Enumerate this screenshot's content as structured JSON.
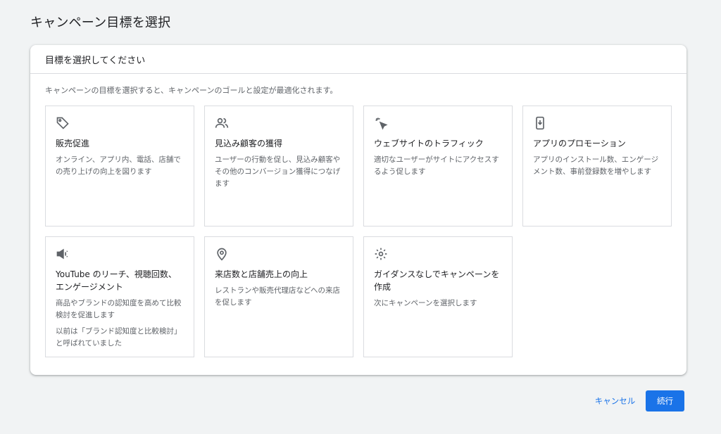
{
  "page_title": "キャンペーン目標を選択",
  "card": {
    "header": "目標を選択してください",
    "description": "キャンペーンの目標を選択すると、キャンペーンのゴールと設定が最適化されます。"
  },
  "goals": [
    {
      "icon": "tag-icon",
      "title": "販売促進",
      "description": "オンライン、アプリ内、電話、店舗での売り上げの向上を図ります",
      "note": ""
    },
    {
      "icon": "people-icon",
      "title": "見込み顧客の獲得",
      "description": "ユーザーの行動を促し、見込み顧客やその他のコンバージョン獲得につなげます",
      "note": ""
    },
    {
      "icon": "cursor-click-icon",
      "title": "ウェブサイトのトラフィック",
      "description": "適切なユーザーがサイトにアクセスするよう促します",
      "note": ""
    },
    {
      "icon": "phone-download-icon",
      "title": "アプリのプロモーション",
      "description": "アプリのインストール数、エンゲージメント数、事前登録数を増やします",
      "note": ""
    },
    {
      "icon": "megaphone-icon",
      "title": "YouTube のリーチ、視聴回数、エンゲージメント",
      "description": "商品やブランドの認知度を高めて比較検討を促進します",
      "note": "以前は「ブランド認知度と比較検討」と呼ばれていました"
    },
    {
      "icon": "location-pin-icon",
      "title": "来店数と店舗売上の向上",
      "description": "レストランや販売代理店などへの来店を促します",
      "note": ""
    },
    {
      "icon": "gear-icon",
      "title": "ガイダンスなしでキャンペーンを作成",
      "description": "次にキャンペーンを選択します",
      "note": ""
    }
  ],
  "buttons": {
    "cancel": "キャンセル",
    "continue": "続行"
  },
  "colors": {
    "accent": "#1a73e8",
    "background": "#f1f3f4",
    "tile_border": "#dadce0",
    "icon": "#5f6368"
  }
}
